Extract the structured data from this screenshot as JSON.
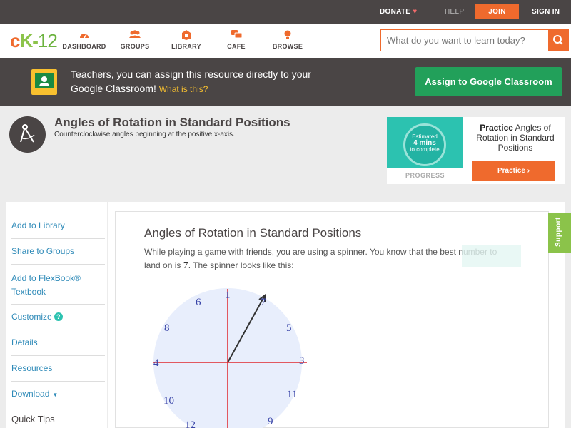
{
  "topbar": {
    "donate": "DONATE",
    "help": "HELP",
    "join": "JOIN",
    "signin": "SIGN IN"
  },
  "nav": {
    "logo": {
      "c": "c",
      "k": "K",
      "dash": "-",
      "num": "12"
    },
    "items": [
      {
        "label": "DASHBOARD",
        "icon": "dashboard-icon"
      },
      {
        "label": "GROUPS",
        "icon": "groups-icon"
      },
      {
        "label": "LIBRARY",
        "icon": "library-icon"
      },
      {
        "label": "CAFE",
        "icon": "cafe-icon"
      },
      {
        "label": "BROWSE",
        "icon": "browse-icon"
      }
    ],
    "search_placeholder": "What do you want to learn today?"
  },
  "classroom": {
    "text": "Teachers, you can assign this resource directly to your Google Classroom!",
    "what": "What is this?",
    "button": "Assign to Google Classroom"
  },
  "concept": {
    "title": "Angles of Rotation in Standard Positions",
    "subtitle": "Counterclockwise angles beginning at the positive x-axis."
  },
  "practice": {
    "estimated": "Estimated",
    "mins": "4 mins",
    "complete": "to complete",
    "progress": "PROGRESS",
    "title_bold": "Practice",
    "title_rest": "Angles of Rotation in Standard Positions",
    "button": "Practice"
  },
  "sidebar": {
    "items": [
      "Add to Library",
      "Share to Groups",
      "Add to FlexBook®",
      "Textbook",
      "Customize",
      "Details",
      "Resources",
      "Download"
    ],
    "quick_tips": "Quick Tips"
  },
  "lesson": {
    "title": "Angles of Rotation in Standard Positions",
    "text_before": "While playing a game with friends, you are using a spinner. You know that the best number to land on is",
    "number": "7",
    "text_after": ". The spinner looks like this:",
    "spinner_labels": [
      "1",
      "7",
      "6",
      "5",
      "8",
      "4",
      "3",
      "10",
      "11",
      "12",
      "9"
    ]
  },
  "support": "Support",
  "colors": {
    "accent": "#ef6a2d",
    "green": "#22a05a",
    "dark": "#4a4545",
    "link": "#2e8ab8",
    "axis": "#e0262d",
    "spinner": "#e8eefc"
  }
}
